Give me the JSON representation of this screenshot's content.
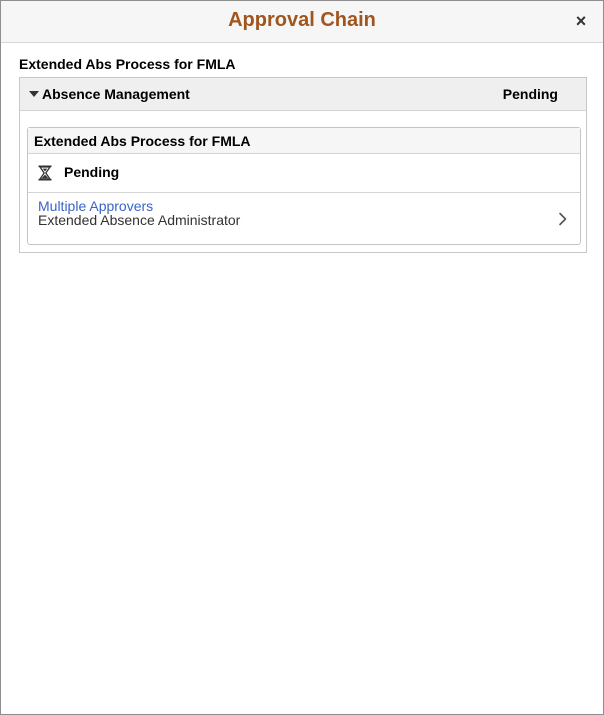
{
  "dialog": {
    "title": "Approval Chain",
    "close_symbol": "×",
    "title_color": "#a0551f"
  },
  "transaction": {
    "title": "Extended Abs Process for FMLA"
  },
  "group": {
    "label": "Absence Management",
    "status": "Pending",
    "expanded": true
  },
  "path": {
    "label": "Extended Abs Process for FMLA",
    "step": {
      "status_icon": "hourglass-icon",
      "status": "Pending",
      "approver_link": "Multiple Approvers",
      "approver_role": "Extended Absence Administrator",
      "link_color": "#3a63c8"
    }
  }
}
